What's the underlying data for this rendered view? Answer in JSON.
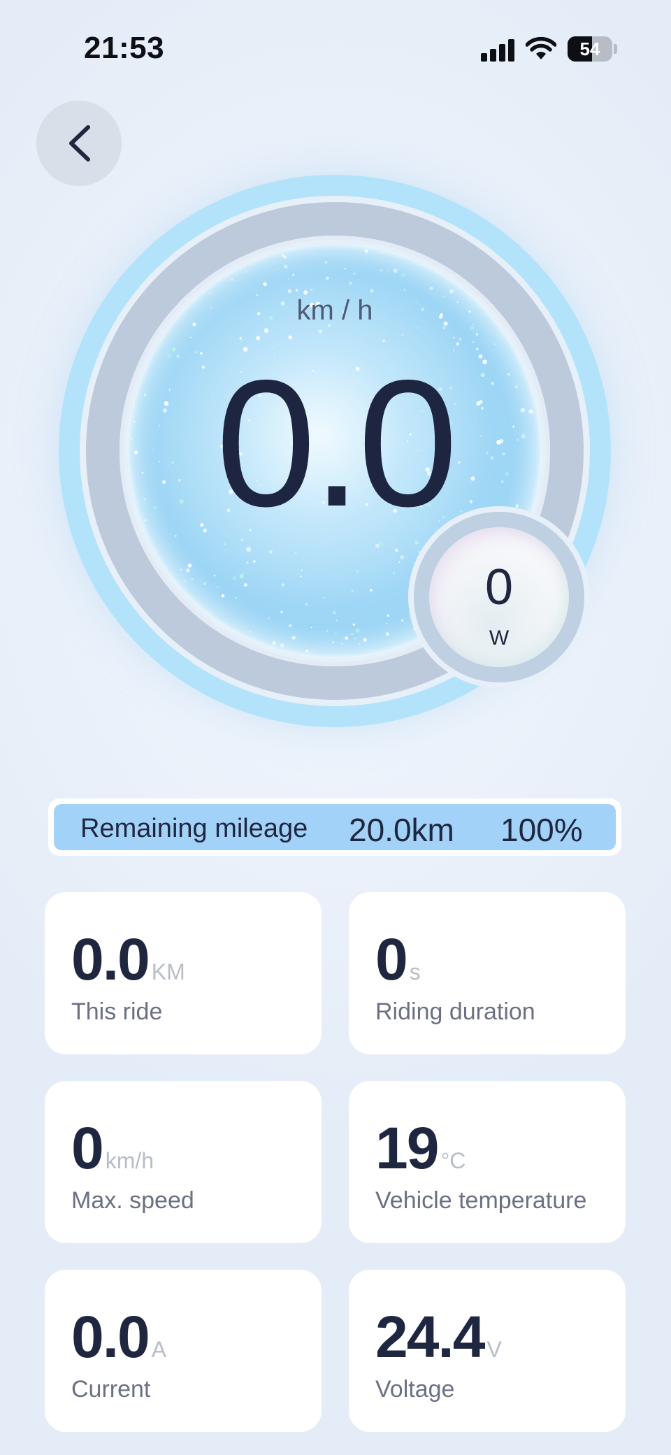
{
  "status_bar": {
    "time": "21:53",
    "battery_level": "54",
    "battery_fraction": 0.54
  },
  "back": {
    "icon": "chevron-left-icon"
  },
  "speedometer": {
    "speed_value": "0.0",
    "speed_unit": "km / h",
    "power_value": "0",
    "power_unit": "W",
    "ring_color": "#b3e3fb",
    "track_color": "#bccadb"
  },
  "mileage": {
    "label": "Remaining mileage",
    "value": "20.0km",
    "percent": "100%",
    "fill_fraction": 1.0,
    "fill_color": "#a3d2f8"
  },
  "stats": [
    {
      "value": "0.0",
      "unit": "KM",
      "label": "This ride"
    },
    {
      "value": "0",
      "unit": "s",
      "label": "Riding duration"
    },
    {
      "value": "0",
      "unit": "km/h",
      "label": "Max. speed"
    },
    {
      "value": "19",
      "unit": "°C",
      "label": "Vehicle temperature"
    },
    {
      "value": "0.0",
      "unit": "A",
      "label": "Current"
    },
    {
      "value": "24.4",
      "unit": "V",
      "label": "Voltage"
    }
  ]
}
